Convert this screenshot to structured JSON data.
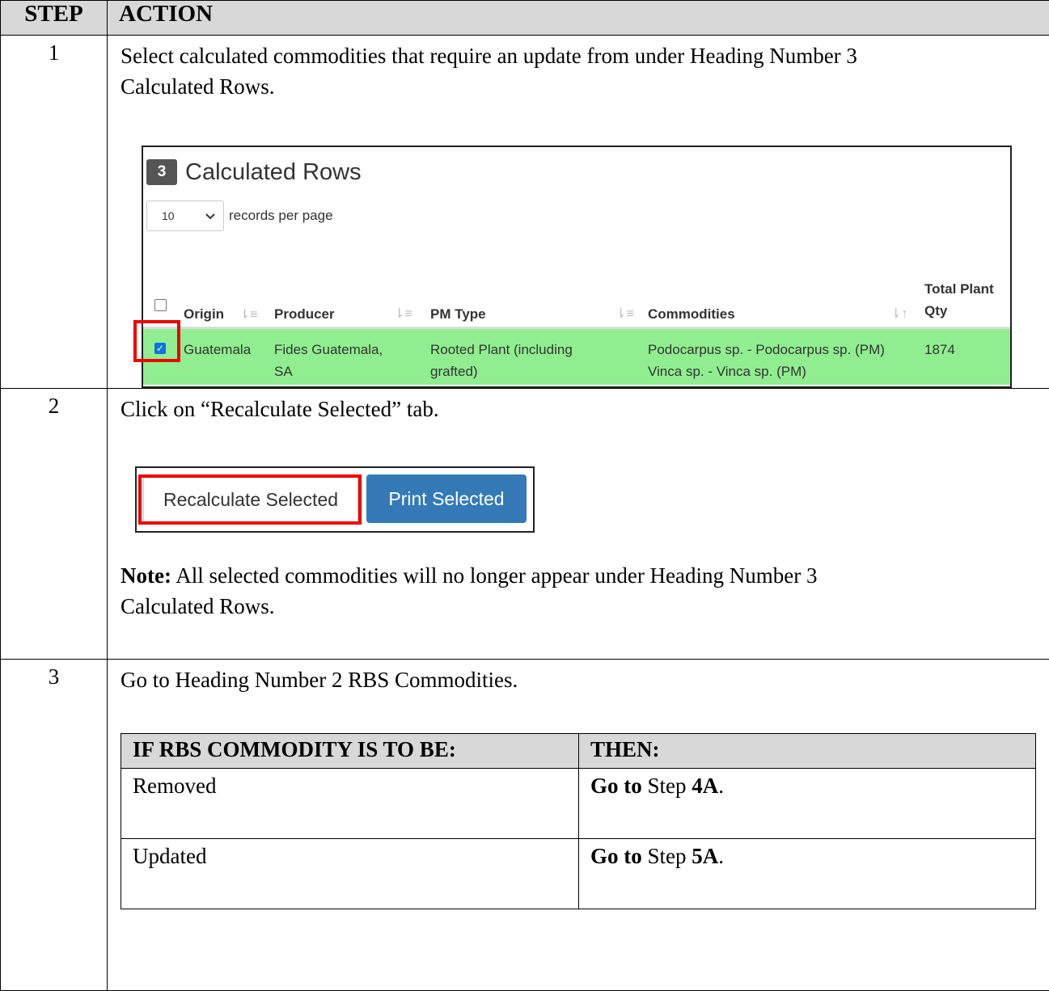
{
  "headers": {
    "step": "STEP",
    "action": "ACTION"
  },
  "rows": [
    {
      "step": "1",
      "text_line1": "Select calculated commodities that require an update from under Heading Number 3",
      "text_line2": "Calculated Rows."
    },
    {
      "step": "2",
      "text": "Click on “Recalculate Selected” tab.",
      "note_label": "Note:",
      "note_line1": " All selected commodities will no longer appear under Heading Number 3",
      "note_line2": "Calculated Rows."
    },
    {
      "step": "3",
      "text": "Go to Heading Number 2 RBS Commodities."
    }
  ],
  "calculated_rows": {
    "badge": "3",
    "title": "Calculated Rows",
    "records_per_page_value": "10",
    "records_per_page_label": "records per page",
    "columns": {
      "origin": "Origin",
      "producer": "Producer",
      "pm_type": "PM Type",
      "commodities": "Commodities",
      "total_line1": "Total Plant",
      "total_line2": "Qty"
    },
    "row": {
      "checked": true,
      "origin": "Guatemala",
      "producer_line1": "Fides Guatemala,",
      "producer_line2": "SA",
      "pm_type_line1": "Rooted Plant (including",
      "pm_type_line2": "grafted)",
      "commodity_line1": "Podocarpus sp. - Podocarpus sp. (PM)",
      "commodity_line2": "Vinca sp. - Vinca sp. (PM)",
      "total": "1874",
      "highlight_color": "#90ee90"
    }
  },
  "buttons": {
    "recalculate": "Recalculate Selected",
    "print": "Print Selected",
    "print_color": "#337ab7",
    "highlight_color": "#e00000"
  },
  "decision_table": {
    "if_header": "IF RBS COMMODITY IS TO BE:",
    "then_header": "THEN:",
    "rows": [
      {
        "if": "Removed",
        "go_to": "Go to",
        "step_word": " Step ",
        "step_ref": "4A",
        "end": "."
      },
      {
        "if": "Updated",
        "go_to": "Go to",
        "step_word": " Step ",
        "step_ref": "5A",
        "end": "."
      }
    ]
  }
}
